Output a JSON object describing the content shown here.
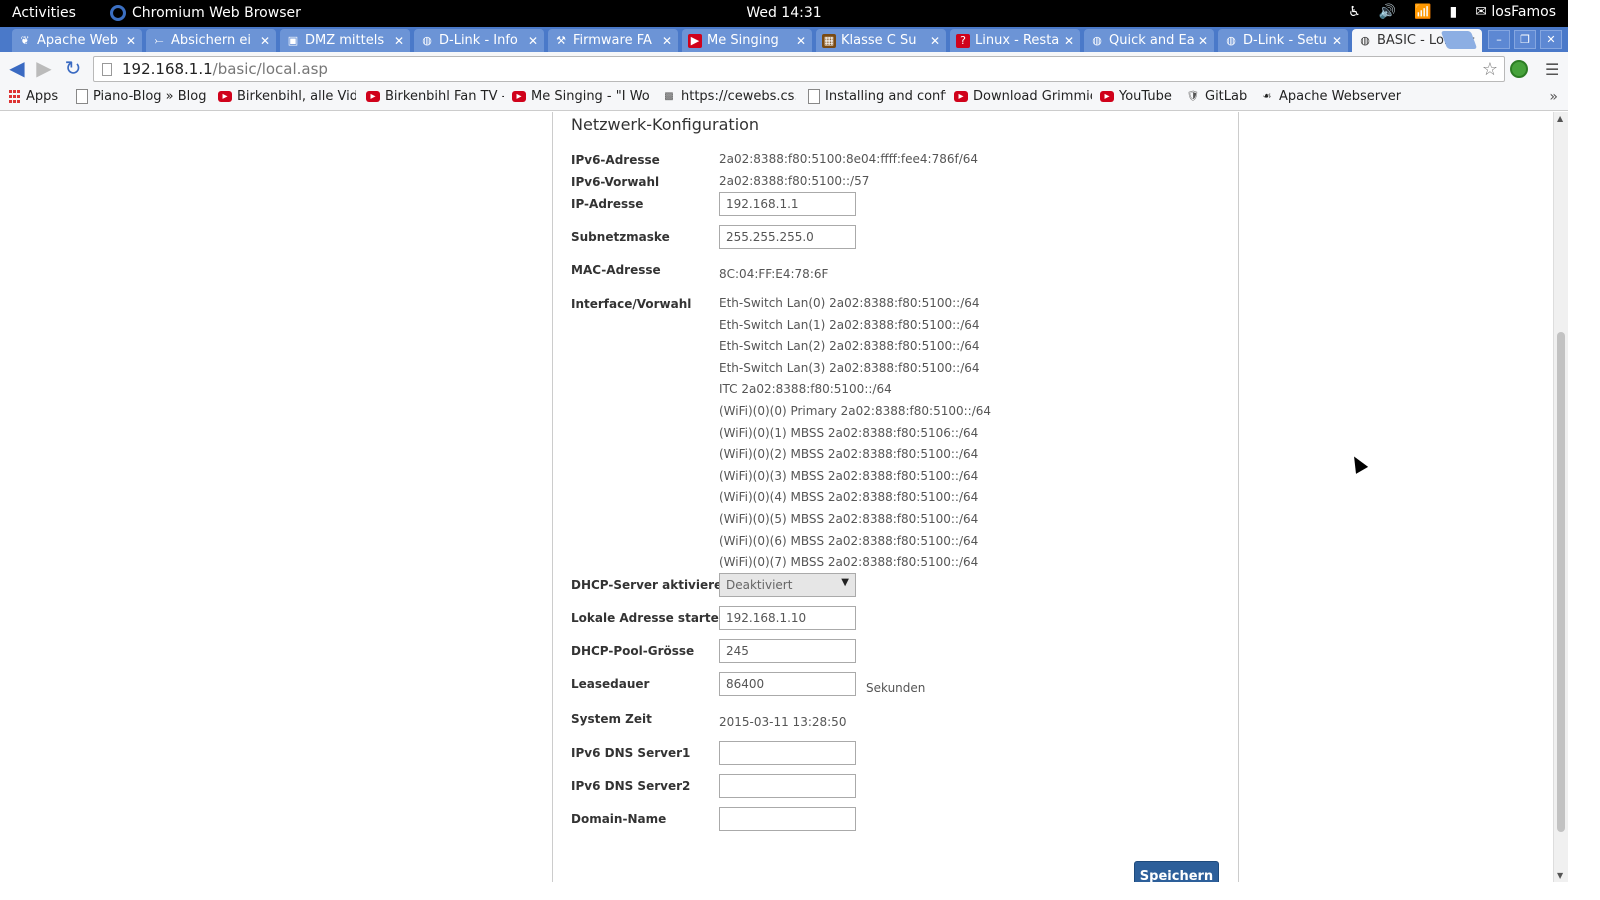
{
  "system_bar": {
    "activities": "Activities",
    "app_name": "Chromium Web Browser",
    "clock": "Wed 14:31",
    "user": "losFamos"
  },
  "tabs": [
    {
      "title": "Apache Web",
      "icon": "apache-feather-icon"
    },
    {
      "title": "Absichern ei",
      "icon": "link-icon"
    },
    {
      "title": "DMZ mittels",
      "icon": "monitor-icon"
    },
    {
      "title": "D-Link - Info",
      "icon": "globe-icon"
    },
    {
      "title": "Firmware FA",
      "icon": "wrench-icon"
    },
    {
      "title": "Me Singing",
      "icon": "youtube-icon"
    },
    {
      "title": "Klasse C Su",
      "icon": "grid-icon"
    },
    {
      "title": "Linux - Resta",
      "icon": "question-icon"
    },
    {
      "title": "Quick and Ea",
      "icon": "globe-icon"
    },
    {
      "title": "D-Link - Setu",
      "icon": "globe-icon"
    },
    {
      "title": "BASIC - Lok",
      "icon": "globe-icon",
      "active": true
    }
  ],
  "address_bar": {
    "host": "192.168.1.1",
    "path": "/basic/local.asp"
  },
  "bookmarks": [
    {
      "label": "Apps",
      "icon": "apps-grid-icon"
    },
    {
      "label": "Piano-Blog » Blog",
      "icon": "page-icon"
    },
    {
      "label": "Birkenbihl, alle Vid",
      "icon": "youtube-icon"
    },
    {
      "label": "Birkenbihl Fan TV -",
      "icon": "youtube-icon"
    },
    {
      "label": "Me Singing - \"I Wo",
      "icon": "youtube-icon"
    },
    {
      "label": "https://cewebs.cs.",
      "icon": "logo-icon"
    },
    {
      "label": "Installing and confi",
      "icon": "page-icon"
    },
    {
      "label": "Download Grimmie",
      "icon": "youtube-icon"
    },
    {
      "label": "YouTube",
      "icon": "youtube-icon"
    },
    {
      "label": "GitLab",
      "icon": "gitlab-icon"
    },
    {
      "label": "Apache Webserver",
      "icon": "apache-feather-icon"
    }
  ],
  "form": {
    "heading": "Netzwerk-Konfiguration",
    "ipv6_address": {
      "label": "IPv6-Adresse",
      "value": "2a02:8388:f80:5100:8e04:ffff:fee4:786f/64"
    },
    "ipv6_prefix": {
      "label": "IPv6-Vorwahl",
      "value": "2a02:8388:f80:5100::/57"
    },
    "ip_address": {
      "label": "IP-Adresse",
      "value": "192.168.1.1"
    },
    "subnet": {
      "label": "Subnetzmaske",
      "value": "255.255.255.0"
    },
    "mac": {
      "label": "MAC-Adresse",
      "value": "8C:04:FF:E4:78:6F"
    },
    "interfaces": {
      "label": "Interface/Vorwahl",
      "items": [
        "Eth-Switch Lan(0) 2a02:8388:f80:5100::/64",
        "Eth-Switch Lan(1) 2a02:8388:f80:5100::/64",
        "Eth-Switch Lan(2) 2a02:8388:f80:5100::/64",
        "Eth-Switch Lan(3) 2a02:8388:f80:5100::/64",
        "ITC 2a02:8388:f80:5100::/64",
        "(WiFi)(0)(0) Primary 2a02:8388:f80:5100::/64",
        "(WiFi)(0)(1) MBSS 2a02:8388:f80:5106::/64",
        "(WiFi)(0)(2) MBSS 2a02:8388:f80:5100::/64",
        "(WiFi)(0)(3) MBSS 2a02:8388:f80:5100::/64",
        "(WiFi)(0)(4) MBSS 2a02:8388:f80:5100::/64",
        "(WiFi)(0)(5) MBSS 2a02:8388:f80:5100::/64",
        "(WiFi)(0)(6) MBSS 2a02:8388:f80:5100::/64",
        "(WiFi)(0)(7) MBSS 2a02:8388:f80:5100::/64"
      ]
    },
    "dhcp": {
      "label": "DHCP-Server aktivieren",
      "value": "Deaktiviert"
    },
    "start_address": {
      "label": "Lokale Adresse starten",
      "value": "192.168.1.10"
    },
    "pool_size": {
      "label": "DHCP-Pool-Grösse",
      "value": "245"
    },
    "lease": {
      "label": "Leasedauer",
      "value": "86400",
      "unit": "Sekunden"
    },
    "system_time": {
      "label": "System Zeit",
      "value": "2015-03-11 13:28:50"
    },
    "dns1": {
      "label": "IPv6 DNS Server1",
      "value": ""
    },
    "dns2": {
      "label": "IPv6 DNS Server2",
      "value": ""
    },
    "domain": {
      "label": "Domain-Name",
      "value": ""
    },
    "save_label": "Speichern"
  }
}
